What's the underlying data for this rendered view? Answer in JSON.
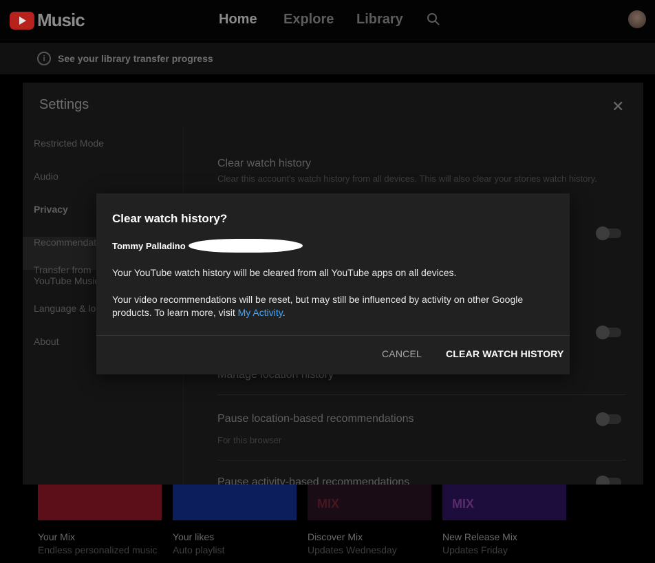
{
  "app": {
    "name": "Music",
    "logo_icon": "youtube-play-icon"
  },
  "nav": {
    "home": "Home",
    "explore": "Explore",
    "library": "Library",
    "search_icon": "search-icon"
  },
  "banner": {
    "icon": "info-icon",
    "text": "See your library transfer progress"
  },
  "settings": {
    "title": "Settings",
    "close_icon": "close-icon",
    "sidebar": [
      {
        "label": "Restricted Mode"
      },
      {
        "label": "Audio"
      },
      {
        "label": "Privacy",
        "selected": true
      },
      {
        "label": "Recommendations"
      },
      {
        "label": "Transfer from YouTube Music"
      },
      {
        "label": "Language & location"
      },
      {
        "label": "About"
      }
    ],
    "privacy": {
      "clear_watch_history": "Clear watch history",
      "clear_watch_history_desc": "Clear this account's watch history from all devices. This will also clear your stories watch history.",
      "manage_location": "Manage location history",
      "pause_location": "Pause location-based recommendations",
      "pause_location_sub": "For this browser",
      "pause_activity": "Pause activity-based recommendations"
    }
  },
  "mixes": [
    {
      "title": "Your Mix",
      "subtitle": "Endless personalized music",
      "color": "#5c0f18"
    },
    {
      "title": "Your likes",
      "subtitle": "Auto playlist",
      "color": "#0c1f5c"
    },
    {
      "title": "Discover Mix",
      "subtitle": "Updates Wednesday",
      "color": "#1a0c14",
      "badge": "MIX"
    },
    {
      "title": "New Release Mix",
      "subtitle": "Updates Friday",
      "color": "#1c0d3c",
      "badge": "MIX"
    }
  ],
  "dialog": {
    "title": "Clear watch history?",
    "account": "Tommy Palladino",
    "paragraph1": "Your YouTube watch history will be cleared from all YouTube apps on all devices.",
    "paragraph2": "Your video recommendations will be reset, but may still be influenced by activity on other Google products. To learn more, visit",
    "link": "My Activity",
    "cancel": "CANCEL",
    "confirm": "CLEAR WATCH HISTORY"
  },
  "colors": {
    "link": "#3ea6ff",
    "dialog_bg": "#212121",
    "brand_red": "#ff0000"
  }
}
